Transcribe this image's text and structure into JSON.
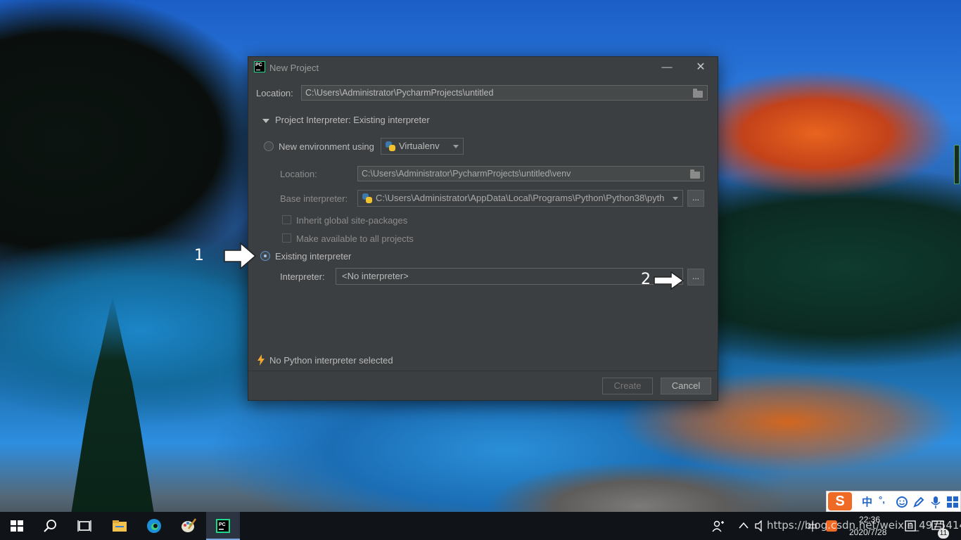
{
  "dialog": {
    "title": "New Project",
    "minimize_glyph": "—",
    "close_glyph": "✕",
    "location_label": "Location:",
    "location_value": "C:\\Users\\Administrator\\PycharmProjects\\untitled",
    "section_title": "Project Interpreter: Existing interpreter",
    "new_env": {
      "label": "New environment using",
      "tool": "Virtualenv",
      "location_label": "Location:",
      "location_value": "C:\\Users\\Administrator\\PycharmProjects\\untitled\\venv",
      "base_label": "Base interpreter:",
      "base_value": "C:\\Users\\Administrator\\AppData\\Local\\Programs\\Python\\Python38\\pyth",
      "inherit_label": "Inherit global site-packages",
      "available_label": "Make available to all projects",
      "browse_label": "..."
    },
    "existing": {
      "label": "Existing interpreter",
      "interpreter_label": "Interpreter:",
      "interpreter_value": "<No interpreter>",
      "browse_label": "..."
    },
    "warning": "No Python interpreter selected",
    "create_label": "Create",
    "cancel_label": "Cancel"
  },
  "annotations": {
    "arrow1_number": "1",
    "arrow2_number": "2"
  },
  "ime": {
    "lang": "中",
    "punct": "°,"
  },
  "tray": {
    "time": "22:36",
    "date": "2020/7/28",
    "input_lang": "中",
    "notifications_count": "11"
  },
  "watermark": "https://blog.csdn.net/weixin_4975414",
  "colors": {
    "dialog_bg": "#3c3f41",
    "accent": "#5a8fcf",
    "taskbar": "#101418"
  }
}
